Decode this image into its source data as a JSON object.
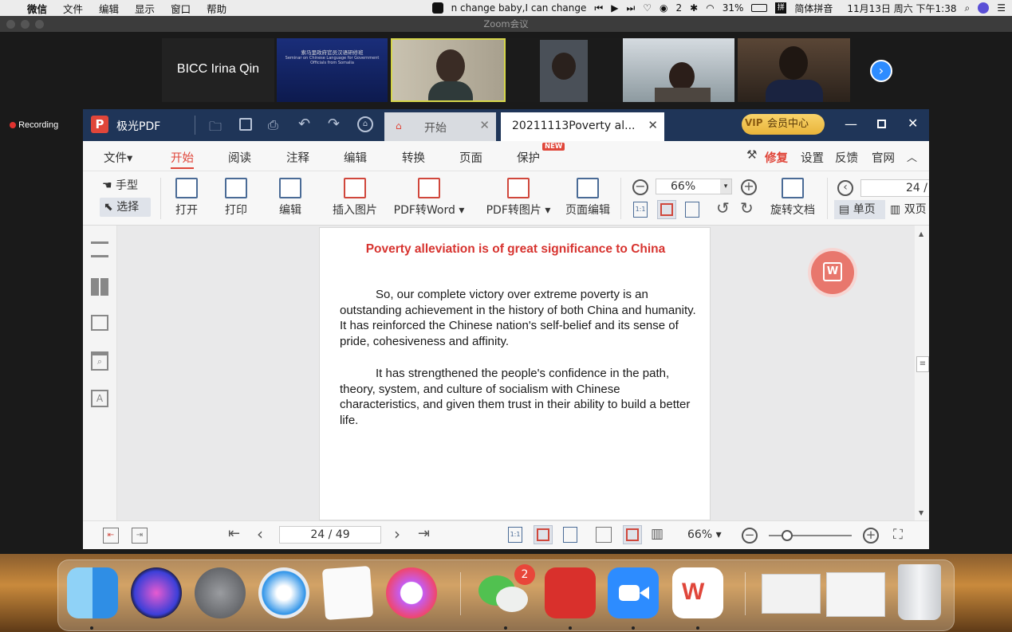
{
  "menubar": {
    "app_menus": [
      "微信",
      "文件",
      "编辑",
      "显示",
      "窗口",
      "帮助"
    ],
    "now_playing": "n change baby,I can change",
    "wechat_count": "2",
    "battery": "31%",
    "input_method": "简体拼音",
    "datetime": "11月13日 周六 下午1:38"
  },
  "zoom": {
    "window_title": "Zoom会议",
    "tile_name": "BICC Irina Qin",
    "recording": "Recording",
    "slide_title_cn": "索马里政府官员汉语研修班",
    "slide_title_en": "Seminar on Chinese Language for Government Officials from Somalia"
  },
  "pdf": {
    "app_name": "极光PDF",
    "tabs": [
      {
        "label": "开始",
        "active": false
      },
      {
        "label": "20211113Poverty al...",
        "active": true
      }
    ],
    "vip": "会员中心",
    "ribbon": {
      "file": "文件▾",
      "tabs": [
        "开始",
        "阅读",
        "注释",
        "编辑",
        "转换",
        "页面",
        "保护"
      ],
      "new_badge": "NEW",
      "right": [
        "修复",
        "设置",
        "反馈",
        "官网"
      ]
    },
    "toolbar": {
      "hand": "手型",
      "select": "选择",
      "buttons": [
        "打开",
        "打印",
        "编辑",
        "插入图片",
        "PDF转Word",
        "PDF转图片",
        "页面编辑"
      ],
      "zoom_value": "66%",
      "rotate_doc": "旋转文档",
      "page_field": "24 /",
      "single_page": "单页",
      "double_page": "双页"
    },
    "page_content": {
      "title": "Poverty alleviation is of great significance to China",
      "para1": "So, our complete victory over extreme poverty is an outstanding achievement in the history of both China and humanity. It has reinforced the Chinese nation's self-belief and its sense of pride, cohesiveness and affinity.",
      "para2": "It has strengthened the people's confidence in the path, theory, system, and culture of socialism with Chinese characteristics, and given them trust in their ability to build a better life."
    },
    "status": {
      "page_indicator": "24 / 49",
      "zoom": "66%",
      "zoom_level": 0.15
    }
  },
  "dock": {
    "wechat_badge": "2",
    "apps": [
      "Finder",
      "Siri",
      "Launchpad",
      "Safari",
      "Reminders",
      "Music",
      "WeChat",
      "NetEase Music",
      "Zoom",
      "WPS"
    ]
  },
  "colors": {
    "pdf_titlebar": "#1f3558",
    "accent_red": "#d7332f",
    "ribbon_active": "#e0463a"
  }
}
